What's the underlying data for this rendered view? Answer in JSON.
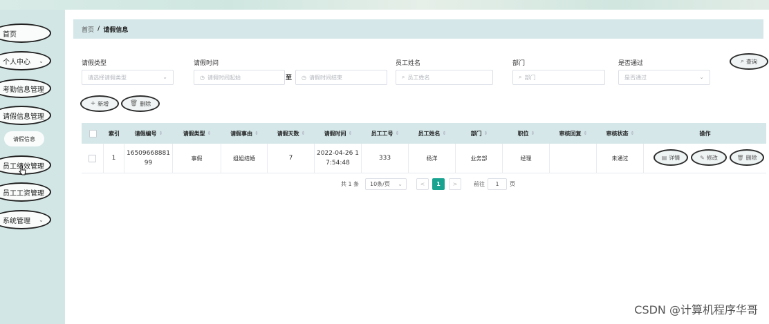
{
  "sidebar": {
    "items": [
      {
        "label": "首页"
      },
      {
        "label": "个人中心"
      },
      {
        "label": "考勤信息管理"
      },
      {
        "label": "请假信息管理"
      },
      {
        "label": "员工绩效管理"
      },
      {
        "label": "员工工资管理"
      },
      {
        "label": "系统管理"
      }
    ],
    "submenu": {
      "label": "请假信息"
    }
  },
  "breadcrumb": {
    "home": "首页",
    "separator": "/",
    "current": "请假信息"
  },
  "filters": {
    "leave_type": {
      "label": "请假类型",
      "placeholder": "请选择请假类型"
    },
    "leave_time": {
      "label": "请假时间",
      "start_placeholder": "请假时间起始",
      "range_sep": "至",
      "end_placeholder": "请假时间结束"
    },
    "employee_name": {
      "label": "员工姓名",
      "placeholder": "员工姓名"
    },
    "department": {
      "label": "部门",
      "placeholder": "部门"
    },
    "approved": {
      "label": "是否通过",
      "placeholder": "是否通过"
    },
    "search_button": "查询"
  },
  "actions": {
    "add": "新增",
    "delete": "删除"
  },
  "table": {
    "columns": [
      "索引",
      "请假编号",
      "请假类型",
      "请假事由",
      "请假天数",
      "请假时间",
      "员工工号",
      "员工姓名",
      "部门",
      "职位",
      "审核回复",
      "审核状态",
      "操作"
    ],
    "rows": [
      {
        "index": "1",
        "leave_no_1": "16509668881",
        "leave_no_2": "99",
        "leave_type": "事假",
        "reason": "姐姐结婚",
        "days": "7",
        "time_1": "2022-04-26 1",
        "time_2": "7:54:48",
        "emp_no": "333",
        "emp_name": "杨洋",
        "dept": "业务部",
        "position": "经理",
        "reply": "",
        "status": "未通过",
        "ops": [
          "详情",
          "修改",
          "删除"
        ]
      }
    ]
  },
  "pagination": {
    "total": "共 1 条",
    "page_size": "10条/页",
    "prev": "<",
    "current": "1",
    "next": ">",
    "goto_label": "前往",
    "goto_value": "1",
    "goto_suffix": "页"
  },
  "watermark": "CSDN @计算机程序华哥",
  "colors": {
    "sidebar_bg": "#d2e6e5",
    "header_bg": "#d5e7e9",
    "accent": "#18a391"
  }
}
